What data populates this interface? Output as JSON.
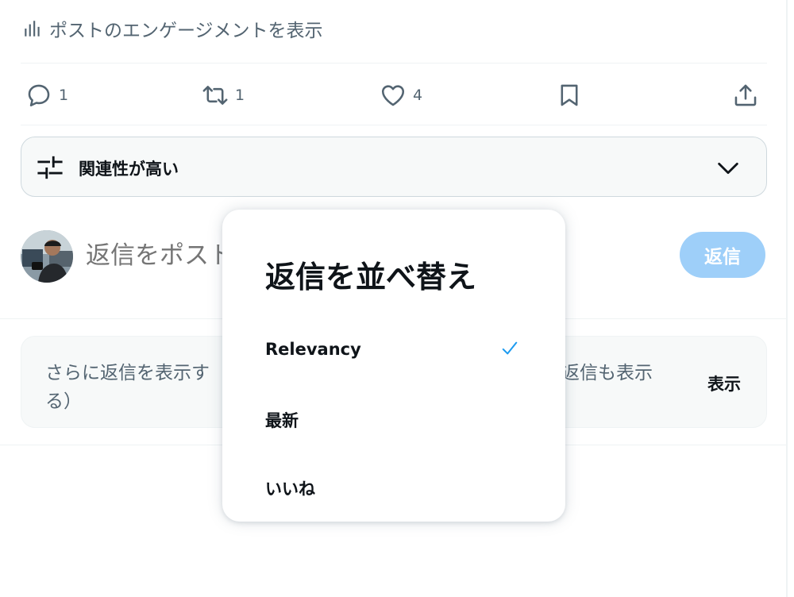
{
  "engagement": {
    "label": "ポストのエンゲージメントを表示",
    "icon": "bar-chart-icon"
  },
  "actions": {
    "reply_count": "1",
    "repost_count": "1",
    "like_count": "4"
  },
  "sort": {
    "current_label": "関連性が高い"
  },
  "composer": {
    "placeholder": "返信をポスト",
    "visible_text": "返信をポス",
    "reply_button": "返信"
  },
  "more_replies": {
    "line1_left": "さらに返信を表示す",
    "line2_left": "る）",
    "line1_right": "返信も表示",
    "show_button": "表示"
  },
  "sort_menu": {
    "title": "返信を並べ替え",
    "items": [
      {
        "label": "Relevancy",
        "selected": true
      },
      {
        "label": "最新",
        "selected": false
      },
      {
        "label": "いいね",
        "selected": false
      }
    ]
  },
  "colors": {
    "accent": "#1d9bf0",
    "reply_button_disabled": "#9ecff9",
    "secondary_text": "#536471",
    "border": "#eff3f4"
  }
}
